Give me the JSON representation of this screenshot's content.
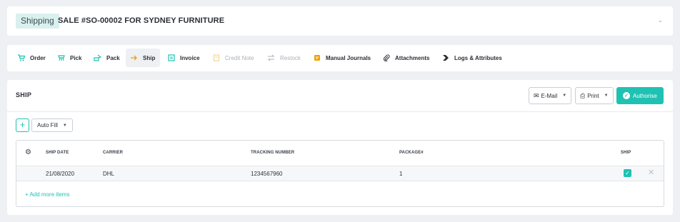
{
  "header": {
    "badge": "Shipping",
    "title": "SALE #SO-00002 FOR SYDNEY FURNITURE",
    "collapse_icon": "chevron-down-icon"
  },
  "tabs": [
    {
      "label": "Order",
      "icon": "cart-icon",
      "state": "normal"
    },
    {
      "label": "Pick",
      "icon": "pick-icon",
      "state": "normal"
    },
    {
      "label": "Pack",
      "icon": "pack-icon",
      "state": "normal"
    },
    {
      "label": "Ship",
      "icon": "arrow-right-icon",
      "state": "active"
    },
    {
      "label": "Invoice",
      "icon": "invoice-icon",
      "state": "normal"
    },
    {
      "label": "Credit Note",
      "icon": "credit-note-icon",
      "state": "disabled"
    },
    {
      "label": "Restock",
      "icon": "restock-icon",
      "state": "disabled"
    },
    {
      "label": "Manual Journals",
      "icon": "journal-icon",
      "state": "normal"
    },
    {
      "label": "Attachments",
      "icon": "paperclip-icon",
      "state": "normal"
    },
    {
      "label": "Logs & Attributes",
      "icon": "logs-icon",
      "state": "normal"
    }
  ],
  "ship": {
    "title": "SHIP",
    "email_label": "E-Mail",
    "print_label": "Print",
    "authorise_label": "Authorise",
    "autofill_label": "Auto Fill",
    "add_more_label": "+ Add more items",
    "columns": {
      "ship_date": "SHIP DATE",
      "carrier": "CARRIER",
      "tracking": "TRACKING NUMBER",
      "package": "PACKAGE#",
      "ship": "SHIP"
    },
    "rows": [
      {
        "ship_date": "21/08/2020",
        "carrier": "DHL",
        "tracking": "1234567960",
        "package": "1",
        "ship": true
      }
    ]
  },
  "colors": {
    "accent": "#1fc2b2",
    "background": "#eef0f3",
    "badge_bg": "#d9f1ee"
  }
}
